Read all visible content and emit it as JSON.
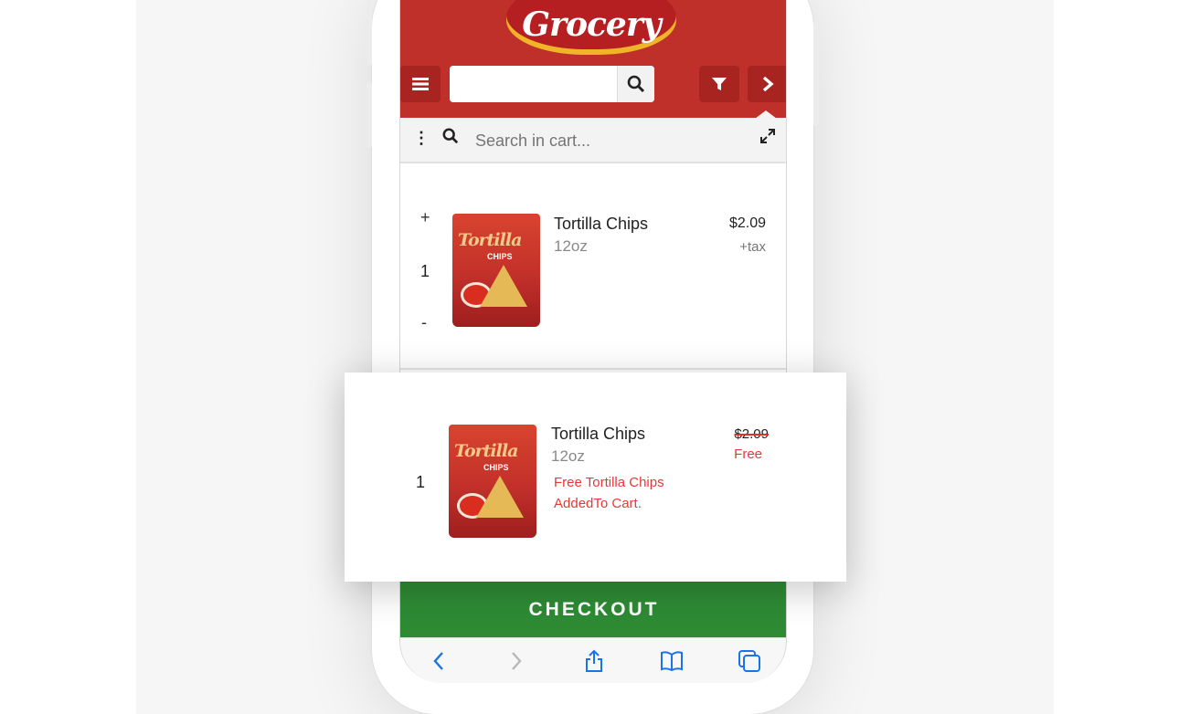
{
  "header": {
    "logo_text": "Grocery",
    "brand_color": "#c0302a",
    "search_value": "",
    "icons": [
      "menu-icon",
      "search-icon",
      "filter-icon",
      "chevron-right-icon"
    ]
  },
  "cart_search": {
    "placeholder": "Search in cart...",
    "icons": [
      "more-vertical-icon",
      "search-icon",
      "expand-icon"
    ]
  },
  "cart_item": {
    "plus": "+",
    "quantity": "1",
    "minus": "-",
    "name": "Tortilla Chips",
    "size": "12oz",
    "price": "$2.09",
    "tax": "+tax",
    "image_label": "Tortilla",
    "image_sub": "CHIPS"
  },
  "popup": {
    "quantity": "1",
    "name": "Tortilla Chips",
    "size": "12oz",
    "original_price": "$2.09",
    "price_label": "Free",
    "message_line1": "Free Tortilla Chips",
    "message_line2": "AddedTo Cart.",
    "accent_color": "#e53935"
  },
  "checkout": {
    "label": "CHECKOUT",
    "color": "#2e8b34"
  },
  "browser_toolbar": {
    "icons": [
      "back-icon",
      "forward-icon",
      "share-icon",
      "bookmarks-icon",
      "tabs-icon"
    ]
  }
}
